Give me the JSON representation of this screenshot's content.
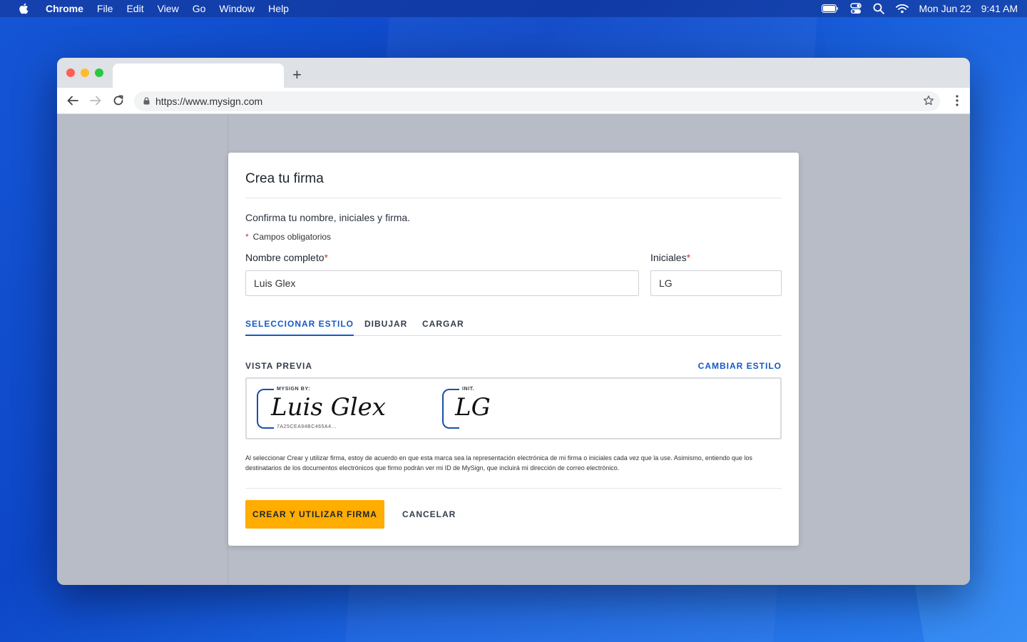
{
  "menubar": {
    "app_name": "Chrome",
    "items": [
      "File",
      "Edit",
      "View",
      "Go",
      "Window",
      "Help"
    ],
    "date": "Mon Jun 22",
    "time": "9:41 AM"
  },
  "browser": {
    "url": "https://www.mysign.com",
    "new_tab_symbol": "+"
  },
  "modal": {
    "title": "Crea tu firma",
    "subtitle": "Confirma tu nombre, iniciales y firma.",
    "required_marker": "*",
    "required_note": "Campos obligatorios",
    "full_name_label": "Nombre completo",
    "full_name_value": "Luis Glex",
    "initials_label": "Iniciales",
    "initials_value": "LG",
    "tabs": [
      {
        "label": "SELECCIONAR ESTILO",
        "active": true
      },
      {
        "label": "DIBUJAR",
        "active": false
      },
      {
        "label": "CARGAR",
        "active": false
      }
    ],
    "preview_label": "VISTA PREVIA",
    "change_style_label": "CAMBIAR ESTILO",
    "signature": {
      "caption": "MYSIGN BY:",
      "script": "Luis Glex",
      "hash": "7A25CEA94BC465A4..."
    },
    "initials_sig": {
      "caption": "INIT.",
      "script": "LG"
    },
    "legal_text": "Al seleccionar Crear y utilizar firma, estoy de acuerdo en que esta marca sea la representación electrónica de mi firma o iniciales cada vez que la use. Asimismo, entiendo que los destinatarios de los documentos electrónicos que firmo podrán ver mi ID de MySign, que incluirá mi dirección de correo electrónico.",
    "create_button": "CREAR Y UTILIZAR FIRMA",
    "cancel_button": "CANCELAR"
  },
  "colors": {
    "accent": "#1559c5",
    "primary_button": "#ffad00",
    "required": "#d6342b"
  }
}
